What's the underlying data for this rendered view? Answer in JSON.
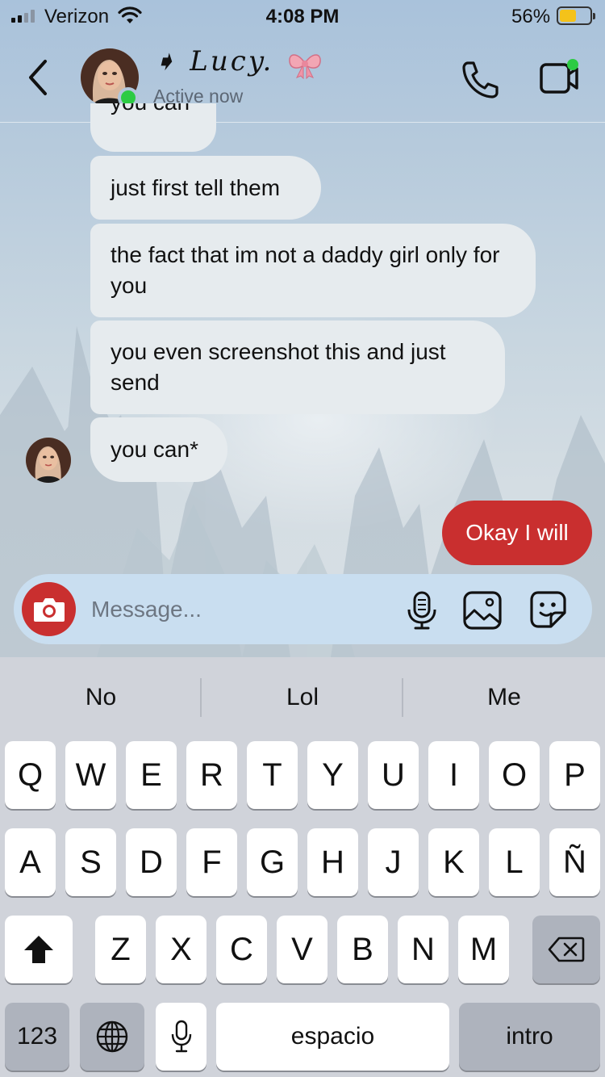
{
  "status_bar": {
    "carrier": "Verizon",
    "time": "4:08 PM",
    "battery_percent": "56%",
    "battery_level": 0.56,
    "signal_bars": 2
  },
  "header": {
    "contact_name": "Lucy.",
    "presence": "Active now"
  },
  "messages": [
    {
      "text": "you can",
      "direction": "incoming",
      "partially_visible": true
    },
    {
      "text": "just first tell them",
      "direction": "incoming"
    },
    {
      "text": "the fact that im not a daddy girl only for you",
      "direction": "incoming"
    },
    {
      "text": "you even screenshot this and just send",
      "direction": "incoming"
    },
    {
      "text": "you can*",
      "direction": "incoming"
    },
    {
      "text": "Okay I will",
      "direction": "outgoing"
    }
  ],
  "composer": {
    "placeholder": "Message..."
  },
  "keyboard": {
    "suggestions": [
      "No",
      "Lol",
      "Me"
    ],
    "row1": [
      "Q",
      "W",
      "E",
      "R",
      "T",
      "Y",
      "U",
      "I",
      "O",
      "P"
    ],
    "row2": [
      "A",
      "S",
      "D",
      "F",
      "G",
      "H",
      "J",
      "K",
      "L",
      "Ñ"
    ],
    "row3": [
      "Z",
      "X",
      "C",
      "V",
      "B",
      "N",
      "M"
    ],
    "numbers_key": "123",
    "space_key": "espacio",
    "return_key": "intro"
  },
  "colors": {
    "accent": "#c92f2f",
    "online": "#2ccb43",
    "incoming_bubble": "#e6ebee",
    "composer": "#c9def0"
  },
  "icons": [
    "back-chevron-icon",
    "phone-icon",
    "video-call-icon",
    "camera-icon",
    "microphone-icon",
    "gallery-icon",
    "sticker-icon",
    "shift-icon",
    "backspace-icon",
    "globe-icon",
    "dictation-icon",
    "bow-icon"
  ]
}
